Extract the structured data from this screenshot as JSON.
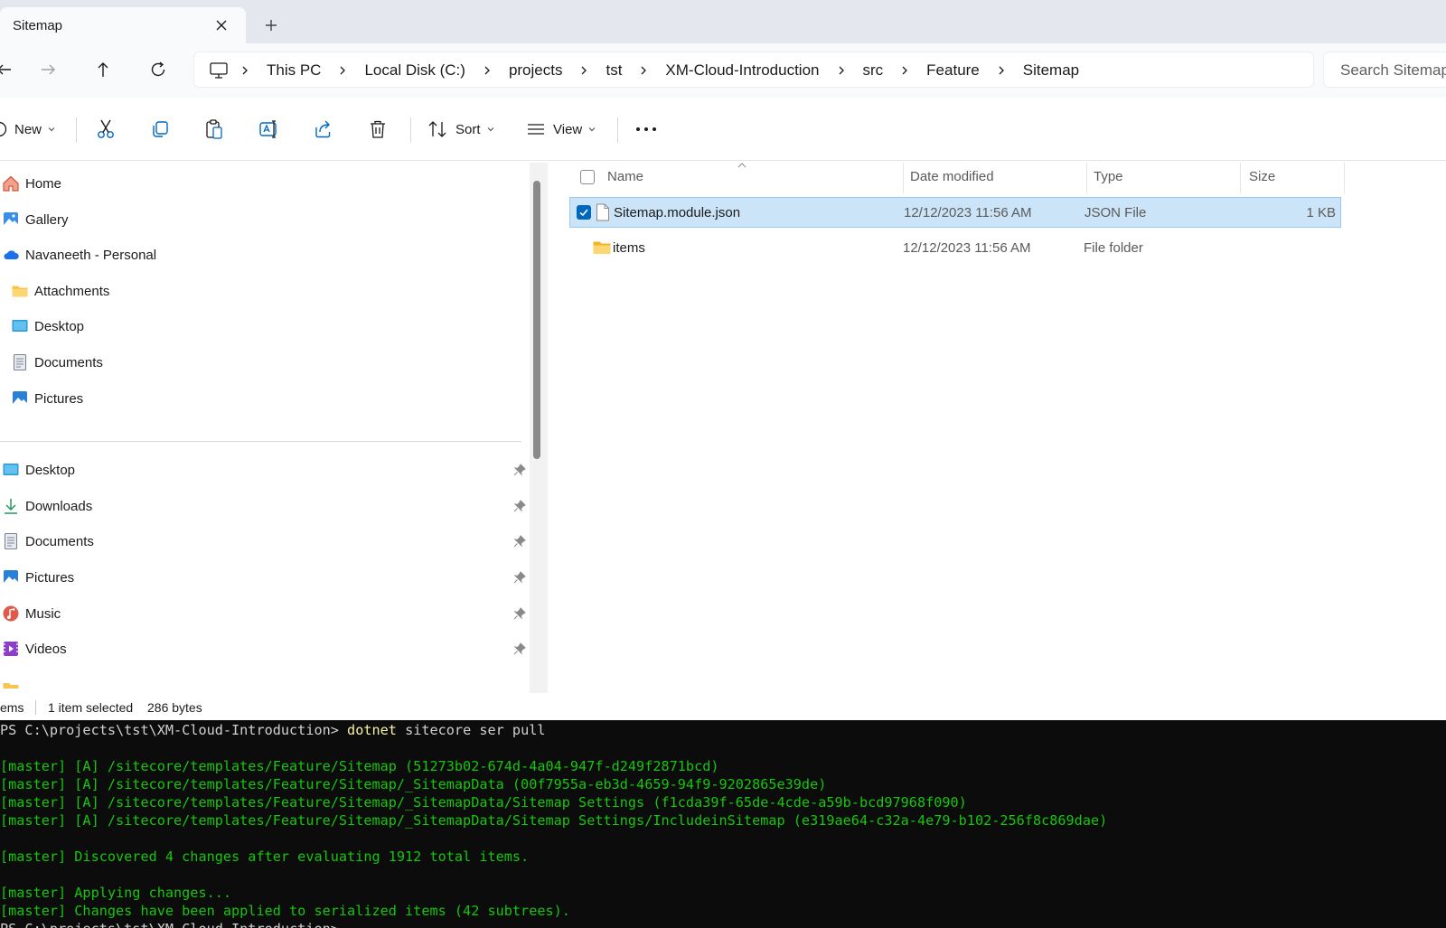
{
  "tab": {
    "title": "Sitemap"
  },
  "breadcrumbs": [
    "This PC",
    "Local Disk (C:)",
    "projects",
    "tst",
    "XM-Cloud-Introduction",
    "src",
    "Feature",
    "Sitemap"
  ],
  "search": {
    "placeholder": "Search Sitemap"
  },
  "toolbar": {
    "new_label": "New",
    "sort_label": "Sort",
    "view_label": "View"
  },
  "sidebar": {
    "top": [
      {
        "label": "Home",
        "icon": "home-icon"
      },
      {
        "label": "Gallery",
        "icon": "gallery-icon"
      },
      {
        "label": "Navaneeth - Personal",
        "icon": "onedrive-cloud-icon"
      }
    ],
    "onedrive_children": [
      {
        "label": "Attachments",
        "icon": "folder-icon"
      },
      {
        "label": "Desktop",
        "icon": "desktop-icon"
      },
      {
        "label": "Documents",
        "icon": "documents-icon"
      },
      {
        "label": "Pictures",
        "icon": "pictures-icon"
      }
    ],
    "pinned": [
      {
        "label": "Desktop",
        "icon": "desktop-icon"
      },
      {
        "label": "Downloads",
        "icon": "downloads-icon"
      },
      {
        "label": "Documents",
        "icon": "documents-icon"
      },
      {
        "label": "Pictures",
        "icon": "pictures-icon"
      },
      {
        "label": "Music",
        "icon": "music-icon"
      },
      {
        "label": "Videos",
        "icon": "videos-icon"
      }
    ]
  },
  "columns": {
    "name": "Name",
    "date": "Date modified",
    "type": "Type",
    "size": "Size"
  },
  "files": [
    {
      "name": "Sitemap.module.json",
      "date": "12/12/2023 11:56 AM",
      "type": "JSON File",
      "size": "1 KB",
      "selected": true,
      "icon": "json-file-icon"
    },
    {
      "name": "items",
      "date": "12/12/2023 11:56 AM",
      "type": "File folder",
      "size": "",
      "selected": false,
      "icon": "folder-icon"
    }
  ],
  "status": {
    "items": "ems",
    "selected": "1 item selected",
    "bytes": "286 bytes"
  },
  "terminal": {
    "prompt": "PS C:\\projects\\tst\\XM-Cloud-Introduction> ",
    "command": "dotnet",
    "args": " sitecore ser pull",
    "lines": [
      "[master] [A] /sitecore/templates/Feature/Sitemap (51273b02-674d-4a04-947f-d249f2871bcd)",
      "[master] [A] /sitecore/templates/Feature/Sitemap/_SitemapData (00f7955a-eb3d-4659-94f9-9202865e39de)",
      "[master] [A] /sitecore/templates/Feature/Sitemap/_SitemapData/Sitemap Settings (f1cda39f-65de-4cde-a59b-bcd97968f090)",
      "[master] [A] /sitecore/templates/Feature/Sitemap/_SitemapData/Sitemap Settings/IncludeinSitemap (e319ae64-c32a-4e79-b102-256f8c869dae)",
      "[master] Discovered 4 changes after evaluating 1912 total items.",
      "[master] Applying changes...",
      "[master] Changes have been applied to serialized items (42 subtrees).",
      "PS C:\\projects\\tst\\XM-Cloud-Introduction>"
    ]
  },
  "colors": {
    "selection": "#cce4f7",
    "accent": "#0067c0",
    "terminal_green": "#16c60c",
    "terminal_yellow": "#f9f1a5",
    "folder": "#f8c44f"
  }
}
